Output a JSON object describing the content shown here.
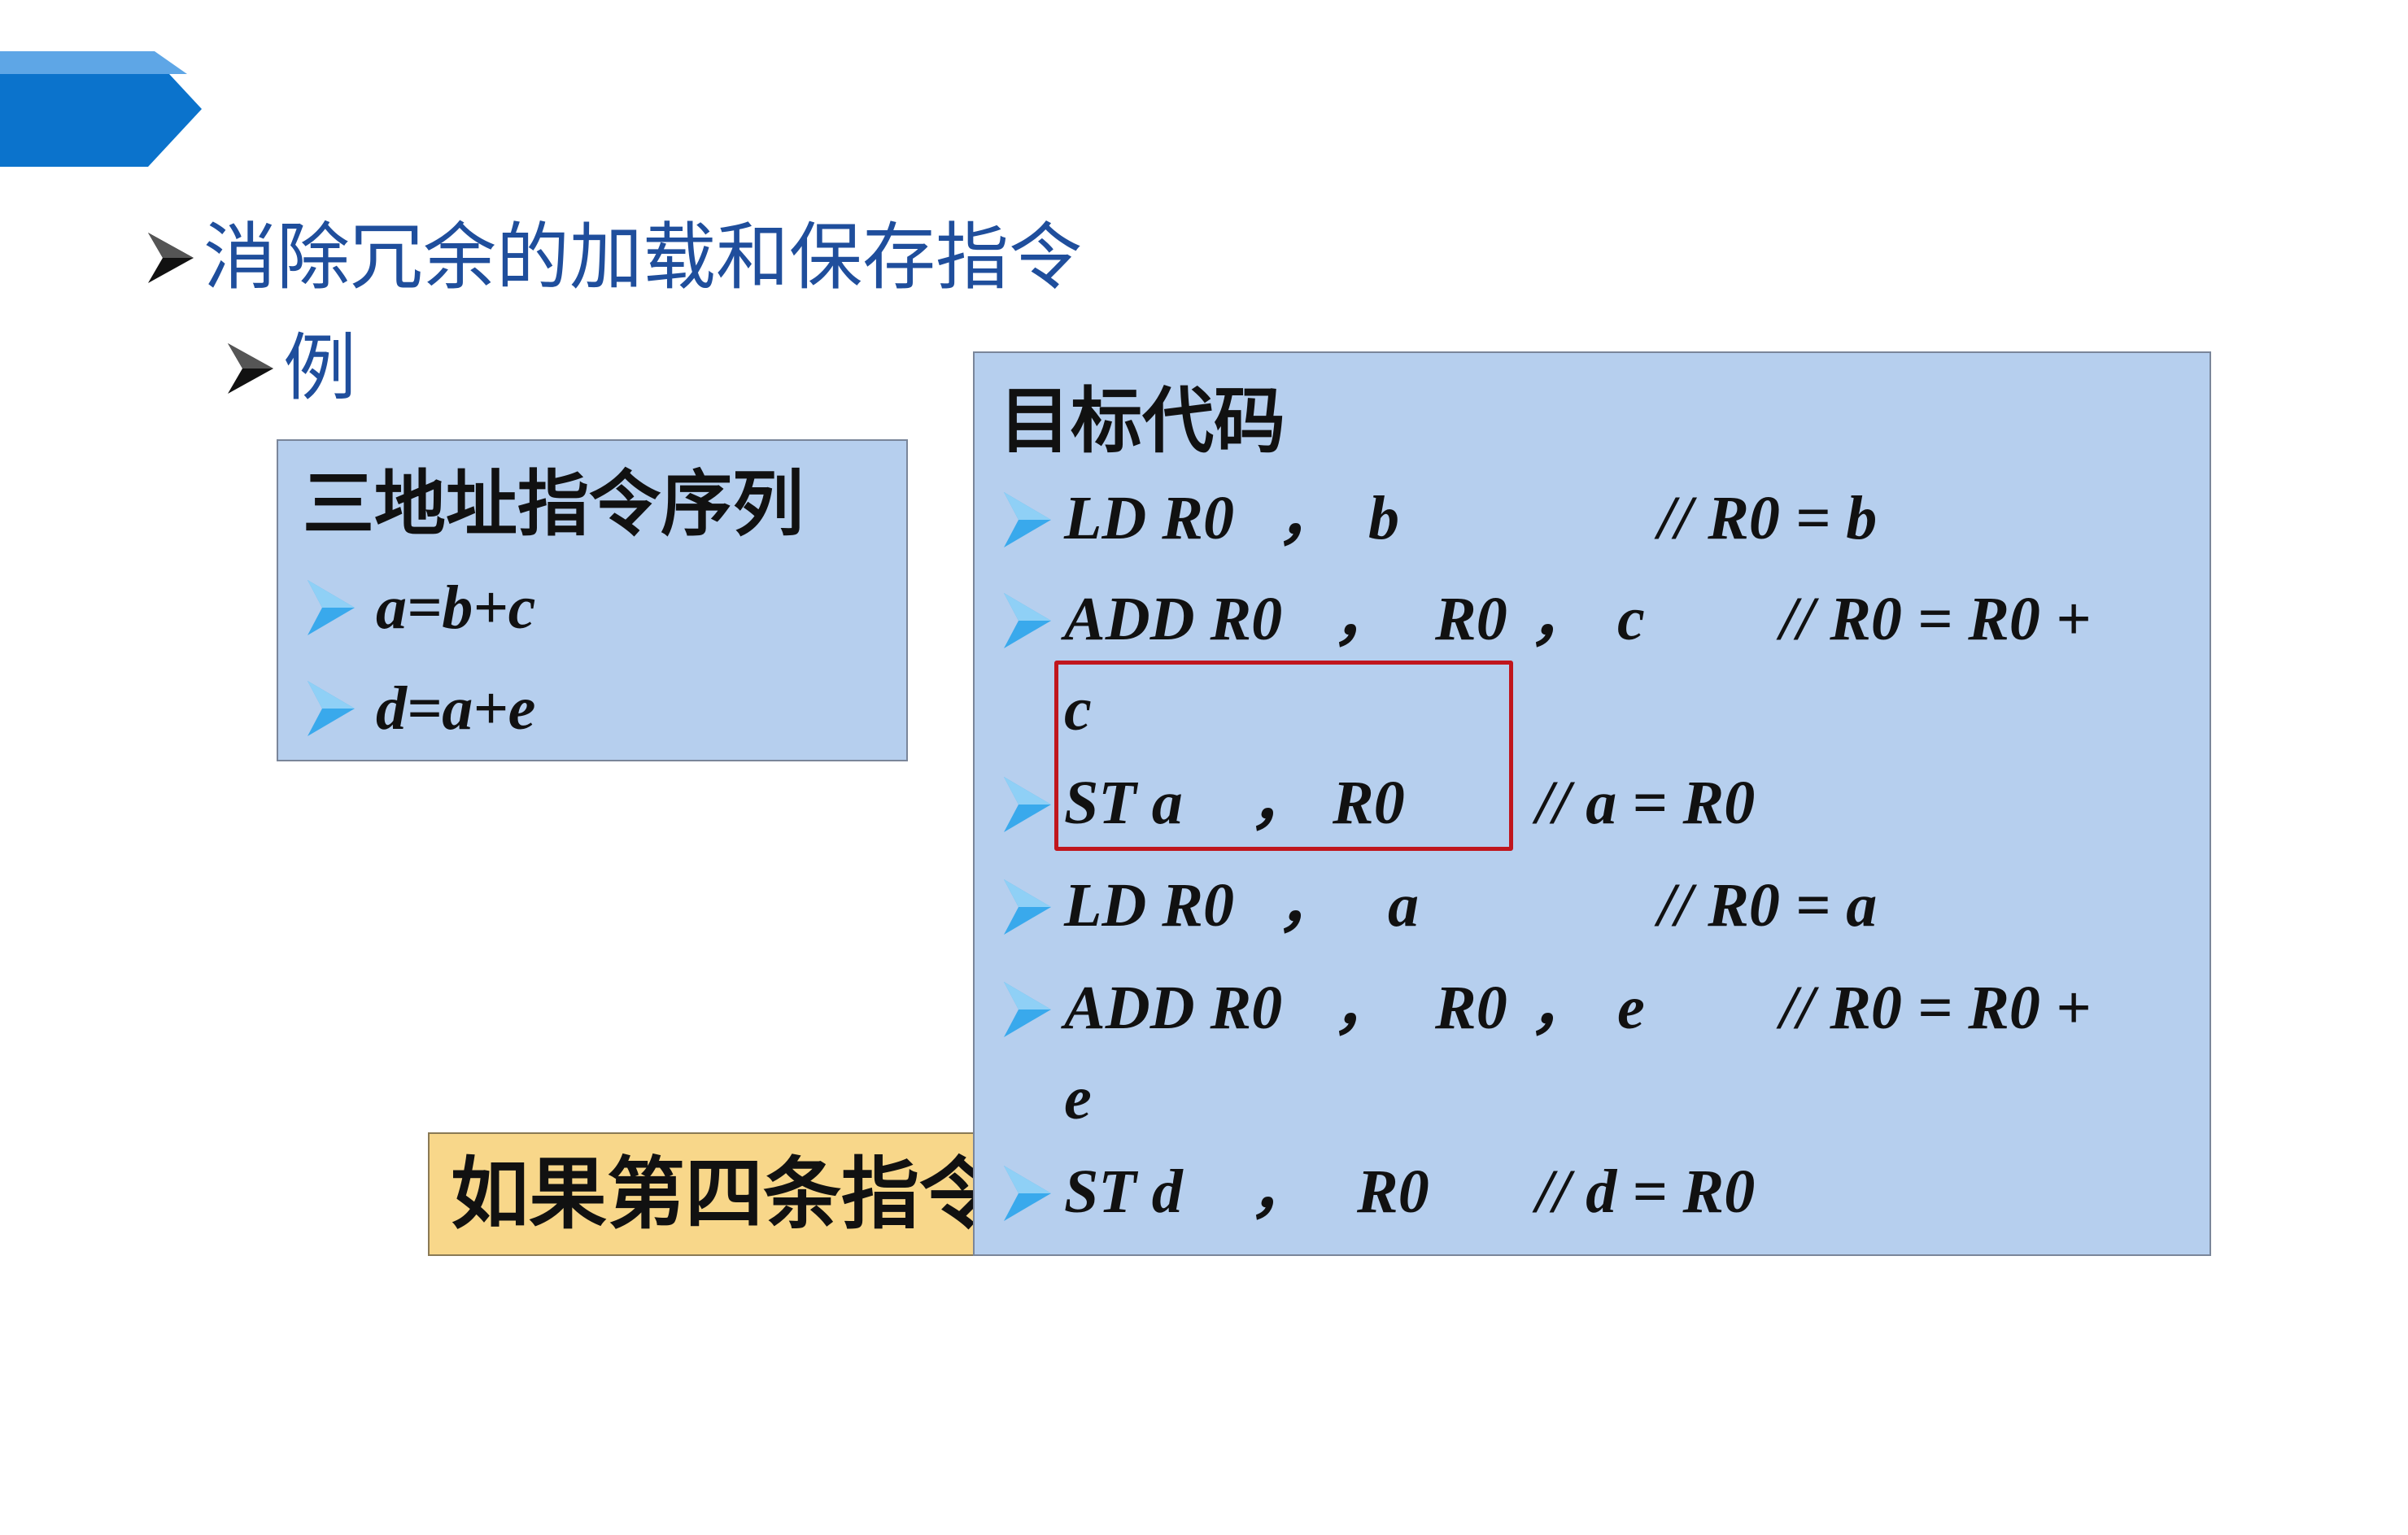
{
  "heading": {
    "main": "消除冗余的加载和保存指令",
    "example": "例"
  },
  "three_address": {
    "title": "三地址指令序列",
    "items": [
      "a=b+c",
      "d=a+e"
    ]
  },
  "target_code": {
    "title": "目标代码",
    "lines": [
      {
        "instr": "LD R0",
        "args": [
          "b"
        ],
        "comment": "// R0 = b"
      },
      {
        "instr": "ADD R0",
        "args": [
          "R0",
          "c"
        ],
        "comment": "// R0 = R0 +",
        "wrap": "c"
      },
      {
        "instr": "ST a",
        "args": [
          "R0"
        ],
        "comment": "// a = R0"
      },
      {
        "instr": "LD R0",
        "args": [
          "a"
        ],
        "comment": "// R0 = a"
      },
      {
        "instr": "ADD R0",
        "args": [
          "R0",
          "e"
        ],
        "comment": "// R0 = R0 +",
        "wrap": "e"
      },
      {
        "instr": "ST d",
        "args": [
          "R0"
        ],
        "comment": "// d = R0"
      }
    ],
    "comma": "，"
  },
  "note": {
    "text": "如果第四条指令"
  },
  "colors": {
    "banner": "#0b73cc",
    "heading_text": "#1f4e9c",
    "box_fill": "#b6cfee",
    "bullet_blue": "#39a9ec",
    "note_fill": "#f8d78a",
    "highlight_border": "#c0161d"
  },
  "icons": {
    "bullet_heading": "arrowhead-bullet-icon",
    "bullet_list": "blue-arrowhead-bullet-icon"
  }
}
